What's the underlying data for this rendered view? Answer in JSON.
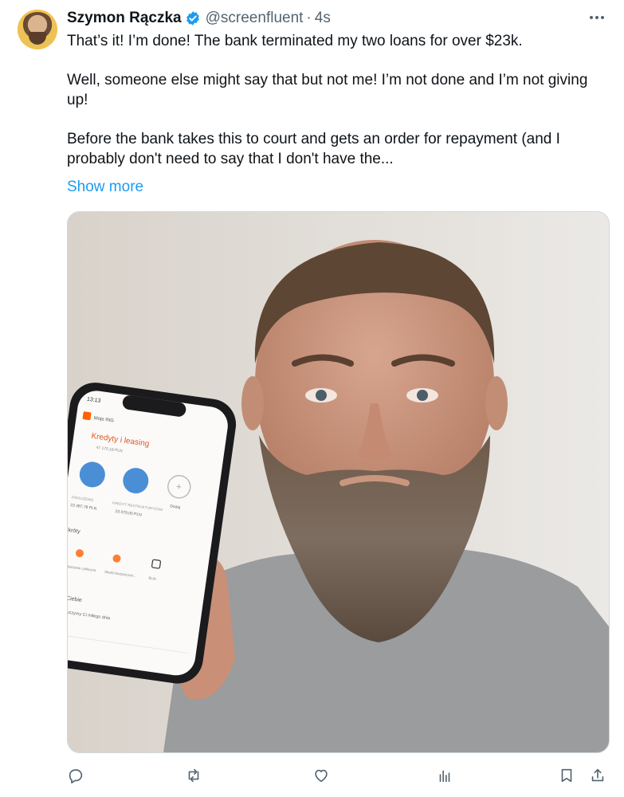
{
  "author": {
    "name": "Szymon Rączka",
    "handle": "@screenfluent",
    "separator": "·",
    "time": "4s"
  },
  "tweet": {
    "paragraphs": [
      "That’s it! I’m done! The bank terminated my two loans for over $23k.",
      "Well, someone else might say that but not me! I’m not done and I’m not giving up!",
      "Before the bank takes this to court and gets an order for repayment (and I probably don't need to say that I don't have the..."
    ],
    "show_more": "Show more"
  },
  "phone_screen": {
    "status_time": "13:13",
    "app_name": "Moje ING",
    "title": "Kredyty i leasing",
    "subtitle": "47 175,18 PLN",
    "accounts": [
      {
        "label": "ZADŁUŻENIE",
        "amount": "23 487,78 PLN"
      },
      {
        "label": "KREDYT RESTRUKTURYZOW",
        "amount": "23 079,00 PLN"
      }
    ],
    "add_label": "Dodaj",
    "shortcuts_title": "Skróty",
    "shortcuts": [
      "Zgłoszenie cykliczne",
      "Skarbi bezpieczeń...",
      "BLIK"
    ],
    "promo_title": "e dla Ciebie",
    "promo_line": "Dzisiaj życzymy Ci miłego dnia"
  },
  "icons": [
    "verified-badge-icon",
    "more-icon",
    "reply-icon",
    "retweet-icon",
    "like-icon",
    "views-icon",
    "bookmark-icon",
    "share-icon"
  ],
  "colors": {
    "accent": "#1d9bf0",
    "text": "#0f1419",
    "muted": "#536471",
    "ing_orange": "#ff6200"
  }
}
